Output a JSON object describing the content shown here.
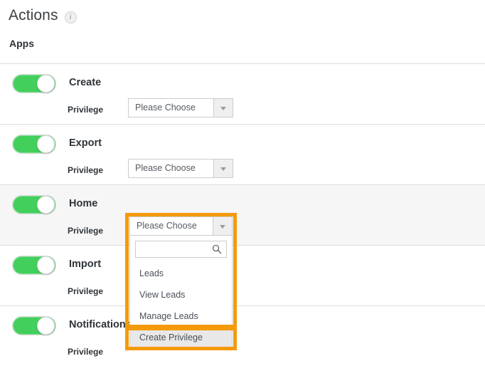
{
  "header": {
    "title": "Actions",
    "info_icon": "info-icon",
    "section_label": "Apps"
  },
  "select": {
    "placeholder": "Please Choose",
    "arrow_icon": "chevron-down-icon"
  },
  "rows": [
    {
      "title": "Create",
      "privilege_label": "Privilege",
      "toggle_on": true,
      "highlighted": false
    },
    {
      "title": "Export",
      "privilege_label": "Privilege",
      "toggle_on": true,
      "highlighted": false
    },
    {
      "title": "Home",
      "privilege_label": "Privilege",
      "toggle_on": true,
      "highlighted": true
    },
    {
      "title": "Import",
      "privilege_label": "Privilege",
      "toggle_on": true,
      "highlighted": false
    },
    {
      "title": "Notifications",
      "privilege_label": "Privilege",
      "toggle_on": true,
      "highlighted": false
    }
  ],
  "dropdown": {
    "trigger_text": "Please Choose",
    "arrow_icon": "chevron-down-icon",
    "search_value": "",
    "search_placeholder": "",
    "search_icon": "search-icon",
    "items": [
      {
        "label": "Leads",
        "selected": false
      },
      {
        "label": "View Leads",
        "selected": false
      },
      {
        "label": "Manage Leads",
        "selected": false
      },
      {
        "label": "Create Privilege",
        "selected": true
      }
    ]
  },
  "annotations": {
    "highlight_color": "#F49A0B",
    "upper_box": "dropdown-highlight",
    "lower_box": "create-privilege-highlight"
  },
  "colors": {
    "toggle_on": "#42cf5c",
    "row_highlight": "#f6f6f6",
    "separator": "#dcdcdc",
    "accent": "#F49A0B"
  }
}
